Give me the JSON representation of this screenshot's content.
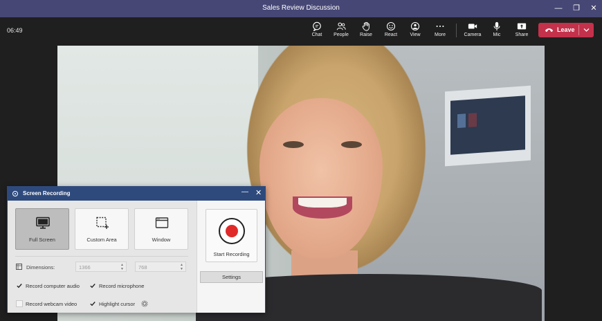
{
  "window": {
    "title": "Sales Review Discussion",
    "controls": {
      "minimize": "—",
      "maximize": "❐",
      "close": "✕"
    }
  },
  "meeting": {
    "timer": "06:49",
    "tools": [
      {
        "label": "Chat",
        "icon": "chat-icon"
      },
      {
        "label": "People",
        "icon": "people-icon"
      },
      {
        "label": "Raise",
        "icon": "hand-icon"
      },
      {
        "label": "React",
        "icon": "smiley-icon"
      },
      {
        "label": "View",
        "icon": "view-icon"
      },
      {
        "label": "More",
        "icon": "more-icon"
      },
      {
        "label": "Camera",
        "icon": "camera-icon"
      },
      {
        "label": "Mic",
        "icon": "mic-icon"
      },
      {
        "label": "Share",
        "icon": "share-icon"
      }
    ],
    "leave_label": "Leave",
    "leave_color": "#c4314b"
  },
  "recorder": {
    "title": "Screen Recording",
    "minimize": "—",
    "close": "✕",
    "modes": [
      {
        "label": "Full Screen",
        "icon": "monitor-icon",
        "selected": true
      },
      {
        "label": "Custom Area",
        "icon": "custom-area-icon",
        "selected": false
      },
      {
        "label": "Window",
        "icon": "window-icon",
        "selected": false
      }
    ],
    "dimensions_label": "Dimensions:",
    "width": "1366",
    "height": "768",
    "options": {
      "record_computer_audio": {
        "label": "Record computer audio",
        "checked": true
      },
      "record_microphone": {
        "label": "Record microphone",
        "checked": true
      },
      "record_webcam_video": {
        "label": "Record webcam video",
        "checked": false
      },
      "highlight_cursor": {
        "label": "Highlight cursor",
        "checked": true
      }
    },
    "start_label": "Start Recording",
    "settings_label": "Settings",
    "accent_color": "#2e4a7d",
    "record_color": "#e02a2a"
  }
}
